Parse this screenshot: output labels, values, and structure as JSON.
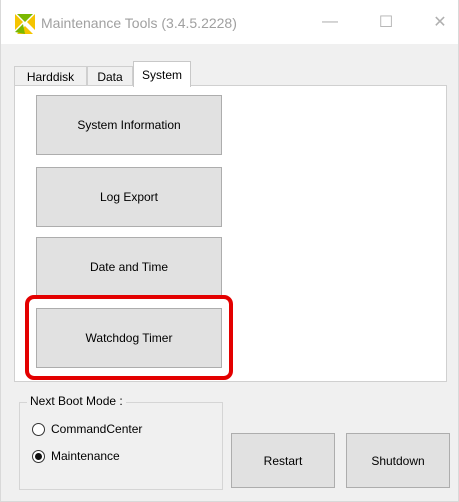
{
  "window": {
    "title": "Maintenance Tools (3.4.5.2228)",
    "minimize_glyph": "—",
    "maximize_glyph": "☐",
    "close_glyph": "✕",
    "icon": "app-logo-icon"
  },
  "tabs": [
    {
      "label": "Harddisk",
      "selected": false
    },
    {
      "label": "Data",
      "selected": false
    },
    {
      "label": "System",
      "selected": true
    }
  ],
  "system_panel": {
    "buttons": [
      {
        "label": "System Information"
      },
      {
        "label": "Log Export"
      },
      {
        "label": "Date and Time"
      },
      {
        "label": "Watchdog Timer",
        "highlighted": true
      }
    ]
  },
  "boot_mode": {
    "legend": "Next Boot Mode :",
    "options": [
      {
        "label": "CommandCenter",
        "checked": false
      },
      {
        "label": "Maintenance",
        "checked": true
      }
    ]
  },
  "actions": {
    "restart_label": "Restart",
    "shutdown_label": "Shutdown"
  },
  "colors": {
    "highlight": "#e30000",
    "logo_yellow": "#f5c400",
    "logo_green": "#7ab800"
  }
}
